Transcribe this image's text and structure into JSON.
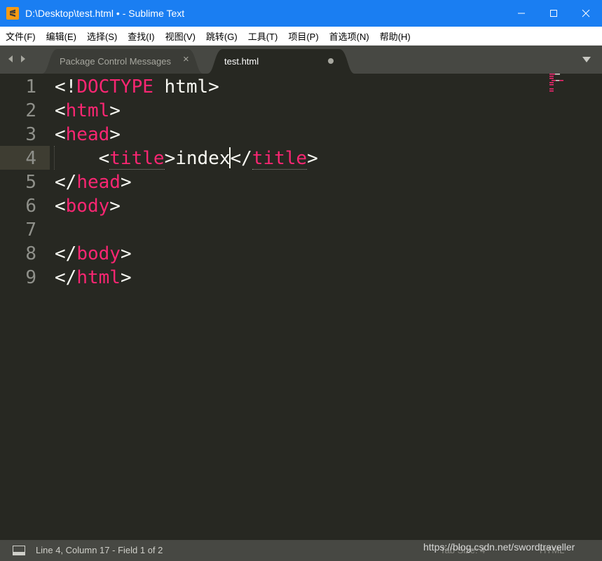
{
  "window": {
    "title": "D:\\Desktop\\test.html • - Sublime Text",
    "icon": "sublime-text-icon",
    "controls": [
      "minimize-icon",
      "maximize-icon",
      "close-icon"
    ]
  },
  "menu": [
    {
      "label": "文件(F)"
    },
    {
      "label": "编辑(E)"
    },
    {
      "label": "选择(S)"
    },
    {
      "label": "查找(I)"
    },
    {
      "label": "视图(V)"
    },
    {
      "label": "跳转(G)"
    },
    {
      "label": "工具(T)"
    },
    {
      "label": "项目(P)"
    },
    {
      "label": "首选项(N)"
    },
    {
      "label": "帮助(H)"
    }
  ],
  "tabs": [
    {
      "label": "Package Control Messages",
      "active": false,
      "close": "×"
    },
    {
      "label": "test.html",
      "active": true,
      "modified": true
    }
  ],
  "editor": {
    "lines": [
      {
        "n": "1",
        "parts": [
          [
            "p",
            "<!"
          ],
          [
            "t",
            "DOCTYPE"
          ],
          [
            "p",
            " html>"
          ]
        ]
      },
      {
        "n": "2",
        "parts": [
          [
            "p",
            "<"
          ],
          [
            "t",
            "html"
          ],
          [
            "p",
            ">"
          ]
        ]
      },
      {
        "n": "3",
        "parts": [
          [
            "p",
            "<"
          ],
          [
            "t",
            "head"
          ],
          [
            "p",
            ">"
          ]
        ]
      },
      {
        "n": "4",
        "parts": [
          [
            "p",
            "    <"
          ],
          [
            "tu",
            "title"
          ],
          [
            "p",
            ">index"
          ],
          [
            "c",
            ""
          ],
          [
            "p",
            "</"
          ],
          [
            "tu",
            "title"
          ],
          [
            "p",
            ">"
          ]
        ]
      },
      {
        "n": "5",
        "parts": [
          [
            "p",
            "</"
          ],
          [
            "t",
            "head"
          ],
          [
            "p",
            ">"
          ]
        ]
      },
      {
        "n": "6",
        "parts": [
          [
            "p",
            "<"
          ],
          [
            "t",
            "body"
          ],
          [
            "p",
            ">"
          ]
        ]
      },
      {
        "n": "7",
        "parts": []
      },
      {
        "n": "8",
        "parts": [
          [
            "p",
            "</"
          ],
          [
            "t",
            "body"
          ],
          [
            "p",
            ">"
          ]
        ]
      },
      {
        "n": "9",
        "parts": [
          [
            "p",
            "</"
          ],
          [
            "t",
            "html"
          ],
          [
            "p",
            ">"
          ]
        ]
      }
    ],
    "current_line": 4
  },
  "colors": {
    "editor_bg": "#272822",
    "tag": "#f92672",
    "text": "#f8f8f2",
    "line_number": "#8f908a",
    "titlebar": "#1a7ef2",
    "chrome": "#474843"
  },
  "status": {
    "position": "Line 4, Column 17 - Field 1 of 2",
    "tab_size": "Tab Size: 4",
    "syntax": "HTML"
  },
  "watermark": "https://blog.csdn.net/swordtraveller"
}
